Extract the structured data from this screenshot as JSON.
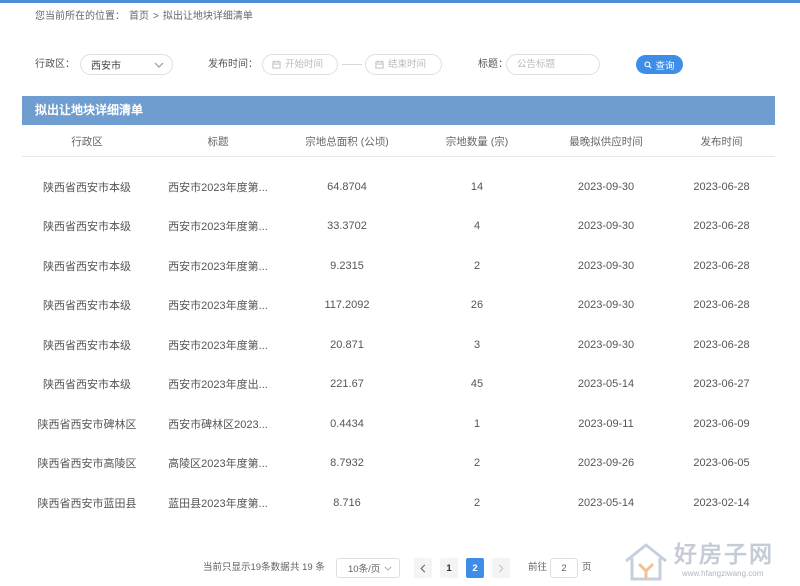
{
  "colors": {
    "top_bar": "#4f8cd8",
    "panel_header": "#6f9dd0",
    "accent": "#3e8ee8",
    "text": "#555555",
    "muted": "#999999",
    "border": "#dcdfe6",
    "pager_bg": "#f4f4f5"
  },
  "icons": {
    "select_caret": "chevron-down-icon",
    "date_field": "calendar-icon",
    "search": "search-icon",
    "prev_page": "chevron-left-icon",
    "next_page": "chevron-right-icon",
    "watermark_logo": "house-icon"
  },
  "breadcrumb": {
    "prefix": "您当前所在的位置：",
    "home": "首页",
    "separator": ">",
    "current": "拟出让地块详细清单"
  },
  "filters": {
    "region_label": "行政区：",
    "region_value": "西安市",
    "date_label": "发布时间：",
    "start_placeholder": "开始时间",
    "end_placeholder": "结束时间",
    "title_label": "标题：",
    "title_placeholder": "公告标题",
    "search_label": "查询"
  },
  "panel": {
    "title": "拟出让地块详细清单"
  },
  "table": {
    "columns": [
      "行政区",
      "标题",
      "宗地总面积 (公顷)",
      "宗地数量 (宗)",
      "最晚拟供应时间",
      "发布时间"
    ],
    "rows": [
      {
        "region": "陕西省西安市本级",
        "title": "西安市2023年度第...",
        "area": "64.8704",
        "count": "14",
        "latest_supply": "2023-09-30",
        "publish_date": "2023-06-28"
      },
      {
        "region": "陕西省西安市本级",
        "title": "西安市2023年度第...",
        "area": "33.3702",
        "count": "4",
        "latest_supply": "2023-09-30",
        "publish_date": "2023-06-28"
      },
      {
        "region": "陕西省西安市本级",
        "title": "西安市2023年度第...",
        "area": "9.2315",
        "count": "2",
        "latest_supply": "2023-09-30",
        "publish_date": "2023-06-28"
      },
      {
        "region": "陕西省西安市本级",
        "title": "西安市2023年度第...",
        "area": "117.2092",
        "count": "26",
        "latest_supply": "2023-09-30",
        "publish_date": "2023-06-28"
      },
      {
        "region": "陕西省西安市本级",
        "title": "西安市2023年度第...",
        "area": "20.871",
        "count": "3",
        "latest_supply": "2023-09-30",
        "publish_date": "2023-06-28"
      },
      {
        "region": "陕西省西安市本级",
        "title": "西安市2023年度出...",
        "area": "221.67",
        "count": "45",
        "latest_supply": "2023-05-14",
        "publish_date": "2023-06-27"
      },
      {
        "region": "陕西省西安市碑林区",
        "title": "西安市碑林区2023...",
        "area": "0.4434",
        "count": "1",
        "latest_supply": "2023-09-11",
        "publish_date": "2023-06-09"
      },
      {
        "region": "陕西省西安市高陵区",
        "title": "高陵区2023年度第...",
        "area": "8.7932",
        "count": "2",
        "latest_supply": "2023-09-26",
        "publish_date": "2023-06-05"
      },
      {
        "region": "陕西省西安市蓝田县",
        "title": "蓝田县2023年度第...",
        "area": "8.716",
        "count": "2",
        "latest_supply": "2023-05-14",
        "publish_date": "2023-02-14"
      }
    ]
  },
  "pagination": {
    "summary": "当前只显示19条数据",
    "total": "共 19 条",
    "page_size": "10条/页",
    "pages": [
      {
        "label": "1",
        "active": false
      },
      {
        "label": "2",
        "active": true
      }
    ],
    "prev_disabled": false,
    "next_disabled": true,
    "goto_label": "前往",
    "goto_value": "2",
    "goto_suffix": "页"
  },
  "watermark": {
    "brand": "好房子网",
    "url": "www.hfangziwang.com"
  }
}
